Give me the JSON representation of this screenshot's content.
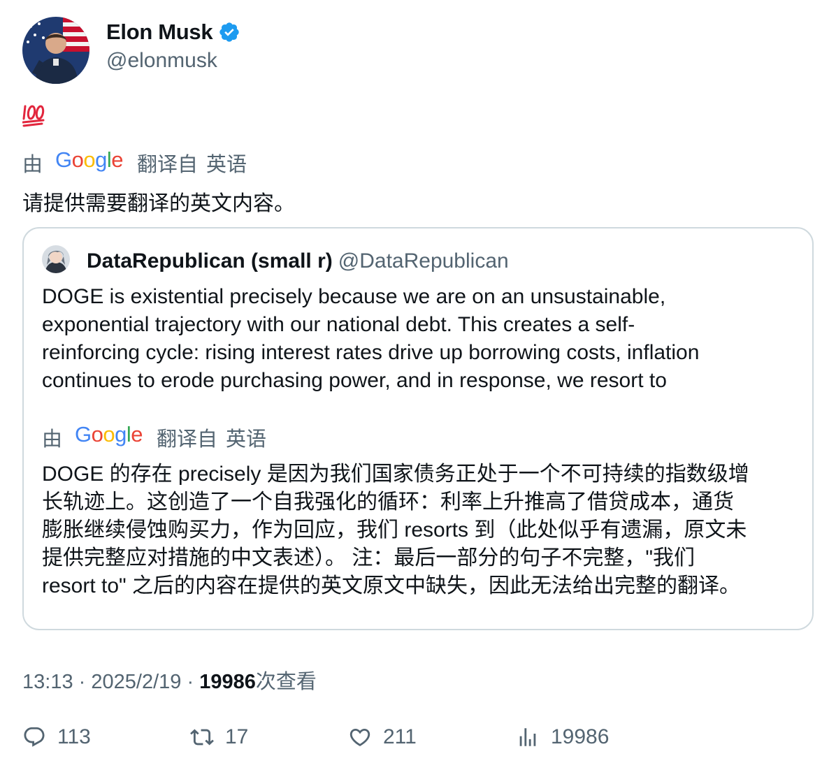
{
  "author": {
    "display_name": "Elon Musk",
    "handle": "@elonmusk",
    "avatar_icon": "avatar-photo",
    "verified_color": "#1d9bf0"
  },
  "tweet": {
    "emoji": "hundred-points-emoji",
    "translation_badge": {
      "by": "由",
      "provider": "Google",
      "from": "翻译自",
      "language": "英语"
    },
    "translated_text": "请提供需要翻译的英文内容。"
  },
  "quoted": {
    "display_name": "DataRepublican (small r)",
    "handle": "@DataRepublican",
    "text_lines": [
      "DOGE is existential precisely because we are on an unsustainable,",
      "exponential trajectory with our national debt. This creates a self-",
      "reinforcing cycle: rising interest rates drive up borrowing costs, inflation",
      "continues to erode purchasing power, and in response, we resort to"
    ],
    "translation_badge": {
      "by": "由",
      "provider": "Google",
      "from": "翻译自",
      "language": "英语"
    },
    "translated_lines": [
      "DOGE 的存在 precisely 是因为我们国家债务正处于一个不可持续的指数级增",
      "长轨迹上。这创造了一个自我强化的循环：利率上升推高了借贷成本，通货",
      "膨胀继续侵蚀购买力，作为回应，我们 resorts 到（此处似乎有遗漏，原文未",
      "提供完整应对措施的中文表述）。 注：最后一部分的句子不完整，\"我们",
      "resort to\" 之后的内容在提供的英文原文中缺失，因此无法给出完整的翻译。"
    ]
  },
  "meta": {
    "time": "13:13",
    "separator": "·",
    "date": "2025/2/19",
    "views_count": "19986",
    "views_label": "次查看"
  },
  "actions": {
    "replies": "113",
    "retweets": "17",
    "likes": "211",
    "views": "19986"
  }
}
